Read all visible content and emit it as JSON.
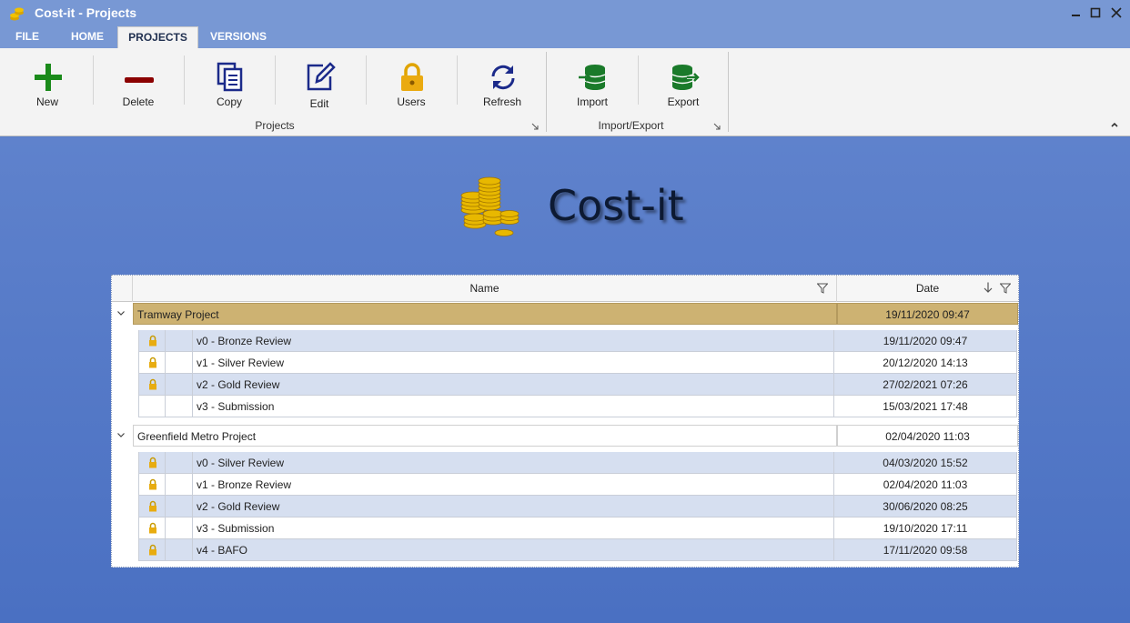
{
  "window": {
    "title": "Cost-it - Projects"
  },
  "tabs": [
    "FILE",
    "HOME",
    "PROJECTS",
    "VERSIONS"
  ],
  "ribbon": {
    "buttons": [
      "New",
      "Delete",
      "Copy",
      "Edit",
      "Users",
      "Refresh",
      "Import",
      "Export"
    ],
    "groups": [
      "Projects",
      "Import/Export"
    ]
  },
  "brand": {
    "name": "Cost-it"
  },
  "grid": {
    "columns": [
      "Name",
      "Date"
    ],
    "projects": [
      {
        "name": "Tramway Project",
        "date": "19/11/2020 09:47",
        "versions": [
          {
            "name": "v0 - Bronze Review",
            "date": "19/11/2020 09:47",
            "locked": true
          },
          {
            "name": "v1 - Silver Review",
            "date": "20/12/2020 14:13",
            "locked": true
          },
          {
            "name": "v2 - Gold Review",
            "date": "27/02/2021 07:26",
            "locked": true
          },
          {
            "name": "v3 - Submission",
            "date": "15/03/2021 17:48",
            "locked": false
          }
        ]
      },
      {
        "name": "Greenfield Metro Project",
        "date": "02/04/2020 11:03",
        "versions": [
          {
            "name": "v0 - Silver Review",
            "date": "04/03/2020 15:52",
            "locked": true
          },
          {
            "name": "v1 - Bronze Review",
            "date": "02/04/2020 11:03",
            "locked": true
          },
          {
            "name": "v2 - Gold Review",
            "date": "30/06/2020 08:25",
            "locked": true
          },
          {
            "name": "v3 - Submission",
            "date": "19/10/2020 17:11",
            "locked": true
          },
          {
            "name": "v4 - BAFO",
            "date": "17/11/2020 09:58",
            "locked": true
          }
        ]
      }
    ]
  },
  "colors": {
    "accent": "#7898d4",
    "selected_row": "#cdb272",
    "alt_row": "#d6dff0"
  }
}
